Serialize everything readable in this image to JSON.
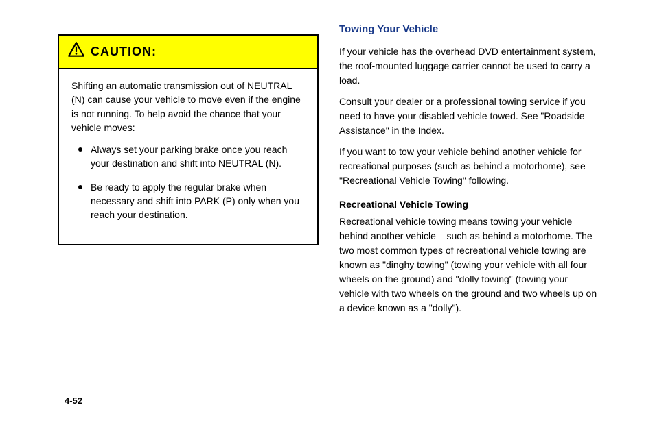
{
  "caution": {
    "title": "CAUTION:",
    "intro": "Shifting an automatic transmission out of NEUTRAL (N) can cause your vehicle to move even if the engine is not running. To help avoid the chance that your vehicle moves:",
    "items": [
      "Always set your parking brake once you reach your destination and shift into NEUTRAL (N).",
      "Be ready to apply the regular brake when necessary and shift into PARK (P) only when you reach your destination."
    ]
  },
  "dinghy": {
    "heading": "Towing Your Vehicle",
    "para1": "If your vehicle has the overhead DVD entertainment system, the roof-mounted luggage carrier cannot be used to carry a load.",
    "para2": "Consult your dealer or a professional towing service if you need to have your disabled vehicle towed. See \"Roadside Assistance\" in the Index.",
    "para3": "If you want to tow your vehicle behind another vehicle for recreational purposes (such as behind a motorhome), see \"Recreational Vehicle Towing\" following.",
    "notice_heading": "Recreational Vehicle Towing",
    "notice_body": "Recreational vehicle towing means towing your vehicle behind another vehicle – such as behind a motorhome. The two most common types of recreational vehicle towing are known as \"dinghy towing\" (towing your vehicle with all four wheels on the ground) and \"dolly towing\" (towing your vehicle with two wheels on the ground and two wheels up on a device known as a \"dolly\")."
  },
  "footer": {
    "left": "4-52",
    "right": ""
  }
}
